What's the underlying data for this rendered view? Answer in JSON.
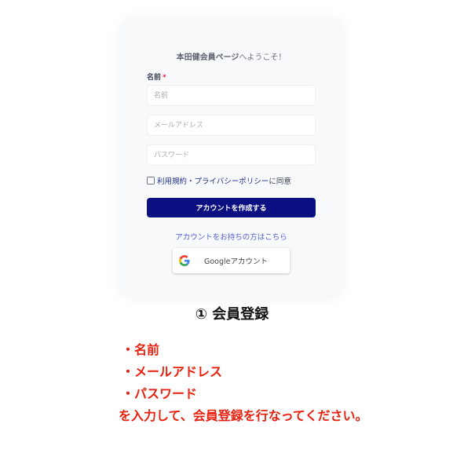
{
  "form": {
    "welcome_brand": "本田健会員ページ",
    "welcome_rest": "へようこそ！",
    "name_label": "名前",
    "required_mark": "*",
    "name_placeholder": "名前",
    "email_placeholder": "メールアドレス",
    "password_placeholder": "パスワード",
    "terms_link": "利用規約・プライバシーポリシー",
    "terms_suffix": "に同意",
    "create_button": "アカウントを作成する",
    "login_link": "アカウントをお持ちの方はこちら",
    "google_button": "Googleアカウント"
  },
  "caption": {
    "step_title": "① 会員登録",
    "items": [
      "・名前",
      "・メールアドレス",
      "・パスワード"
    ],
    "footer": "を入力して、会員登録を行なってください。"
  },
  "colors": {
    "primary_button": "#0b0f82",
    "link": "#4f5fd1",
    "instruction_text": "#e8210f"
  },
  "icons": {
    "google": "google-g-icon",
    "checkbox": "checkbox-icon"
  }
}
